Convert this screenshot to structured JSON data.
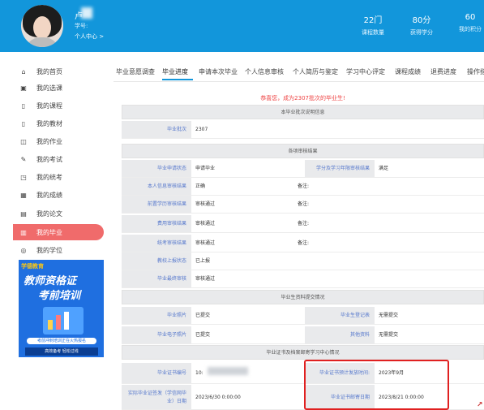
{
  "header": {
    "user_name": "卢",
    "user_sub": "学号:",
    "user_center": "个人中心 >",
    "stats": [
      {
        "value": "22门",
        "label": "课程数量"
      },
      {
        "value": "80分",
        "label": "获得学分"
      },
      {
        "value": "60",
        "label": "我的积分"
      }
    ],
    "bg_color": "#1296db"
  },
  "sidebar": {
    "items": [
      {
        "label": "我的首页",
        "icon": "home-icon",
        "glyph": "⌂"
      },
      {
        "label": "我的选课",
        "icon": "course-select-icon",
        "glyph": "▣"
      },
      {
        "label": "我的课程",
        "icon": "course-icon",
        "glyph": "▯"
      },
      {
        "label": "我的教材",
        "icon": "book-icon",
        "glyph": "▯"
      },
      {
        "label": "我的作业",
        "icon": "homework-icon",
        "glyph": "◫"
      },
      {
        "label": "我的考试",
        "icon": "exam-icon",
        "glyph": "✎"
      },
      {
        "label": "我的统考",
        "icon": "unified-exam-icon",
        "glyph": "◳"
      },
      {
        "label": "我的成绩",
        "icon": "score-icon",
        "glyph": "▦"
      },
      {
        "label": "我的论文",
        "icon": "thesis-icon",
        "glyph": "▤"
      },
      {
        "label": "我的毕业",
        "icon": "graduation-icon",
        "glyph": "▥",
        "active": true
      },
      {
        "label": "我的学位",
        "icon": "degree-icon",
        "glyph": "◎"
      }
    ],
    "active_color": "#f06b6b",
    "ad": {
      "logo": "学德教育",
      "title1": "教师资格证",
      "title2": "考前培训",
      "band": "考前冲刺培训正在火热报名",
      "band2": "高效备考 轻松过线"
    }
  },
  "tabs": [
    "毕业意愿调查",
    "毕业进度",
    "申请本次毕业",
    "个人信息审核",
    "个人简历与鉴定",
    "学习中心评定",
    "课程成绩",
    "退费进度",
    "操作指"
  ],
  "active_tab": "毕业进度",
  "notice": "恭喜您，成为2307批次的毕业生!",
  "sections": {
    "batch_info": "本毕业批次说明信息",
    "review_result": "各项审核结果",
    "materials": "毕业生资料提交情况",
    "certificate": "毕业证书及档案邮寄学习中心情况"
  },
  "rows": {
    "batch_label": "毕业批次",
    "batch_value": "2307",
    "apply_status_label": "毕业申请状态",
    "apply_status_value": "申请毕业",
    "record_result_label": "学分及学习年限审核结果",
    "record_result_value": "满足",
    "personal_info_label": "本人信息审核结果",
    "personal_info_value": "正确",
    "note_label": "备注:",
    "prior_cert_label": "前置学历审核结果",
    "prior_cert_value": "审核通过",
    "fee_label": "费用审核结果",
    "fee_value": "审核通过",
    "unified_label": "统考审核结果",
    "unified_value": "审核通过",
    "school_report_label": "教校上报状态",
    "school_report_value": "已上报",
    "final_label": "毕业最终审核",
    "final_value": "审核通过",
    "photo_label": "毕业照片",
    "photo_value": "已提交",
    "register_label": "毕业生登记表",
    "register_value": "无需提交",
    "e_photo_label": "毕业电子照片",
    "e_photo_value": "已提交",
    "other_label": "其他资料",
    "other_value": "无需提交",
    "cert_no_label": "毕业证书编号",
    "cert_no_value": "10:",
    "issue_time_label": "毕业证书预计发放时间:",
    "issue_time_value": "2023年9月",
    "sign_date_label": "实际毕业证签发（学信网毕业）日期",
    "sign_date_value": "2023/6/30 0:00:00",
    "mail_date_label": "毕业证书邮寄日期",
    "mail_date_value": "2023/8/21 0:00:00"
  },
  "colors": {
    "notice": "#e44444",
    "highlight_box": "#e02020",
    "label_text": "#5577cc"
  }
}
